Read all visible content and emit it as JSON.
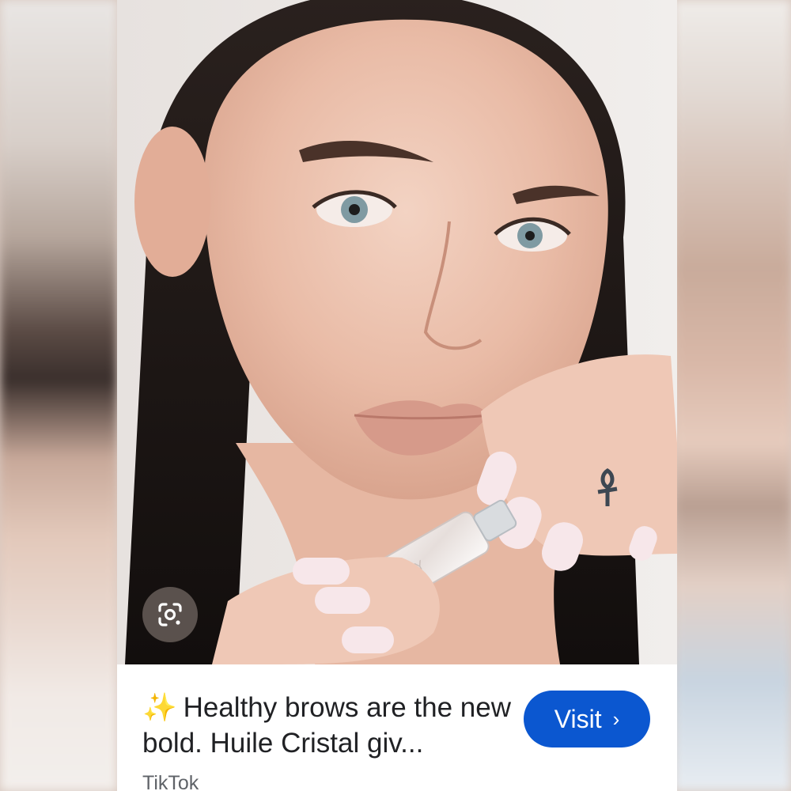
{
  "result": {
    "title_emoji": "✨",
    "title_text": "Healthy brows are the new bold. Huile Cristal giv...",
    "source": "TikTok",
    "visit_label": "Visit",
    "visit_chevron": "›"
  },
  "icons": {
    "lens": "google-lens-icon",
    "chevron": "chevron-right-icon"
  },
  "colors": {
    "visit_button_bg": "#0b57d0",
    "title_text": "#202124",
    "source_text": "#5f6368"
  }
}
